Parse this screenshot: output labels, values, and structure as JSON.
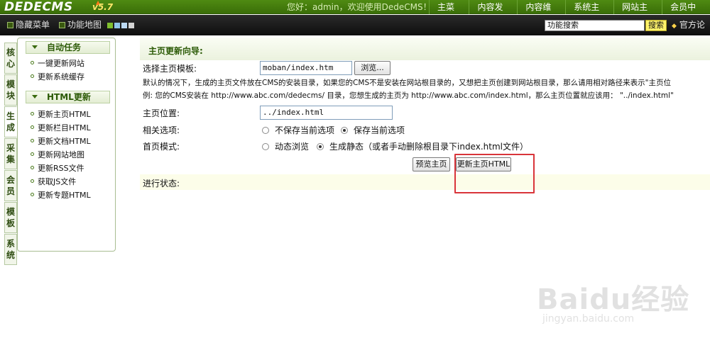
{
  "header": {
    "logo": "DEDECMS",
    "version": "v5.7",
    "welcome": "您好：admin，欢迎使用DedeCMS！",
    "nav": [
      "主菜单",
      "内容发布",
      "内容维护",
      "系统主页",
      "网站主页",
      "会员中心"
    ]
  },
  "toolbar": {
    "hide_menu": "隐藏菜单",
    "func_map": "功能地图",
    "search_value": "功能搜索",
    "search_button": "搜索",
    "forum": "官方论"
  },
  "swatch_colors": [
    "#7fbf2e",
    "#8fc4ea",
    "#bcd9f2",
    "#d3d3d3"
  ],
  "vtabs": [
    {
      "chars": [
        "核",
        "心"
      ]
    },
    {
      "chars": [
        "模",
        "块"
      ]
    },
    {
      "chars": [
        "生",
        "成"
      ]
    },
    {
      "chars": [
        "采",
        "集"
      ]
    },
    {
      "chars": [
        "会",
        "员"
      ]
    },
    {
      "chars": [
        "模",
        "板"
      ]
    },
    {
      "chars": [
        "系",
        "统"
      ]
    }
  ],
  "sidebar": {
    "group1_title": "自动任务",
    "group1_items": [
      "一键更新网站",
      "更新系统缓存"
    ],
    "group2_title": "HTML更新",
    "group2_items": [
      "更新主页HTML",
      "更新栏目HTML",
      "更新文档HTML",
      "更新网站地图",
      "更新RSS文件",
      "获取JS文件",
      "更新专题HTML"
    ]
  },
  "main": {
    "title": "主页更新向导:",
    "template_label": "选择主页模板:",
    "template_value": "moban/index.htm",
    "browse_button": "浏览...",
    "desc_line1": "默认的情况下，生成的主页文件放在CMS的安装目录，如果您的CMS不是安装在网站根目录的，又想把主页创建到网站根目录，那么请用相对路径来表示\"主页位",
    "desc_line2": "例: 您的CMS安装在 http://www.abc.com/dedecms/ 目录，您想生成的主页为 http://www.abc.com/index.html，那么主页位置就应该用： \"../index.html\"",
    "position_label": "主页位置:",
    "position_value": "../index.html",
    "option_label": "相关选项:",
    "option_a": "不保存当前选项",
    "option_b": "保存当前选项",
    "mode_label": "首页模式:",
    "mode_a": "动态浏览",
    "mode_b": "生成静态（或者手动删除根目录下index.html文件）",
    "preview_button": "预览主页",
    "update_button": "更新主页HTML",
    "status_label": "进行状态:"
  },
  "watermark": {
    "brand": "Baidu经验",
    "url": "jingyan.baidu.com"
  }
}
